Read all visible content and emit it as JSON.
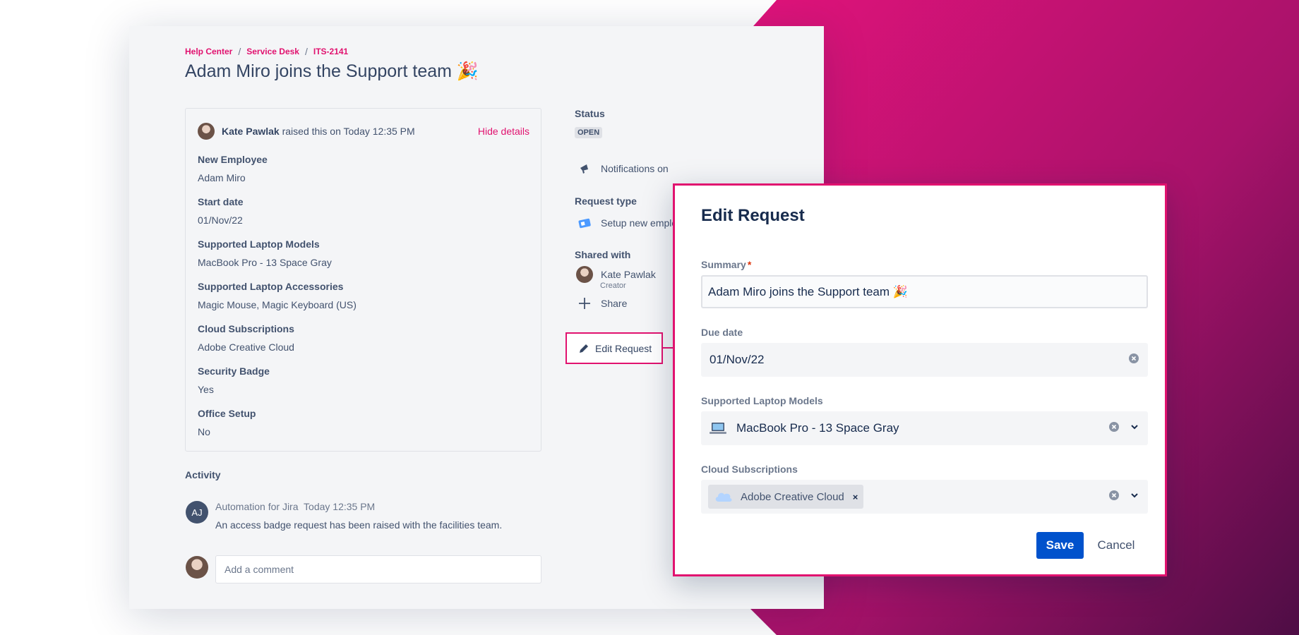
{
  "colors": {
    "accent": "#e1126f",
    "primary": "#0052cc",
    "gradient_start": "#e1137b",
    "gradient_end": "#5a0e4a"
  },
  "breadcrumb": {
    "items": [
      "Help Center",
      "Service Desk",
      "ITS-2141"
    ],
    "separator": "/"
  },
  "title": "Adam Miro joins the Support team 🎉",
  "details": {
    "reporter": "Kate Pawlak",
    "raised_text": "raised this on Today 12:35 PM",
    "hide_details": "Hide details",
    "fields": [
      {
        "label": "New Employee",
        "value": "Adam Miro"
      },
      {
        "label": "Start date",
        "value": "01/Nov/22"
      },
      {
        "label": "Supported Laptop Models",
        "value": "MacBook Pro - 13 Space Gray"
      },
      {
        "label": "Supported Laptop Accessories",
        "value": "Magic Mouse, Magic Keyboard (US)"
      },
      {
        "label": "Cloud Subscriptions",
        "value": "Adobe Creative Cloud"
      },
      {
        "label": "Security Badge",
        "value": "Yes"
      },
      {
        "label": "Office Setup",
        "value": "No"
      }
    ]
  },
  "activity": {
    "title": "Activity",
    "avatar_initials": "AJ",
    "author": "Automation for Jira",
    "time": "Today 12:35 PM",
    "message": "An access badge request has been raised with the facilities team.",
    "comment_placeholder": "Add a comment"
  },
  "sidebar": {
    "status_label": "Status",
    "status_value": "OPEN",
    "notifications": "Notifications on",
    "request_type_label": "Request type",
    "request_type_value": "Setup new emplo",
    "shared_with_label": "Shared with",
    "shared_name": "Kate Pawlak",
    "shared_role": "Creator",
    "share": "Share",
    "edit_request": "Edit Request"
  },
  "modal": {
    "title": "Edit Request",
    "summary_label": "Summary",
    "summary_required": "*",
    "summary_value": "Adam Miro joins the Support team 🎉",
    "due_label": "Due date",
    "due_value": "01/Nov/22",
    "laptop_label": "Supported Laptop Models",
    "laptop_value": "MacBook Pro - 13 Space Gray",
    "cloud_label": "Cloud Subscriptions",
    "cloud_tag": "Adobe Creative Cloud",
    "tag_remove": "×",
    "save": "Save",
    "cancel": "Cancel"
  }
}
